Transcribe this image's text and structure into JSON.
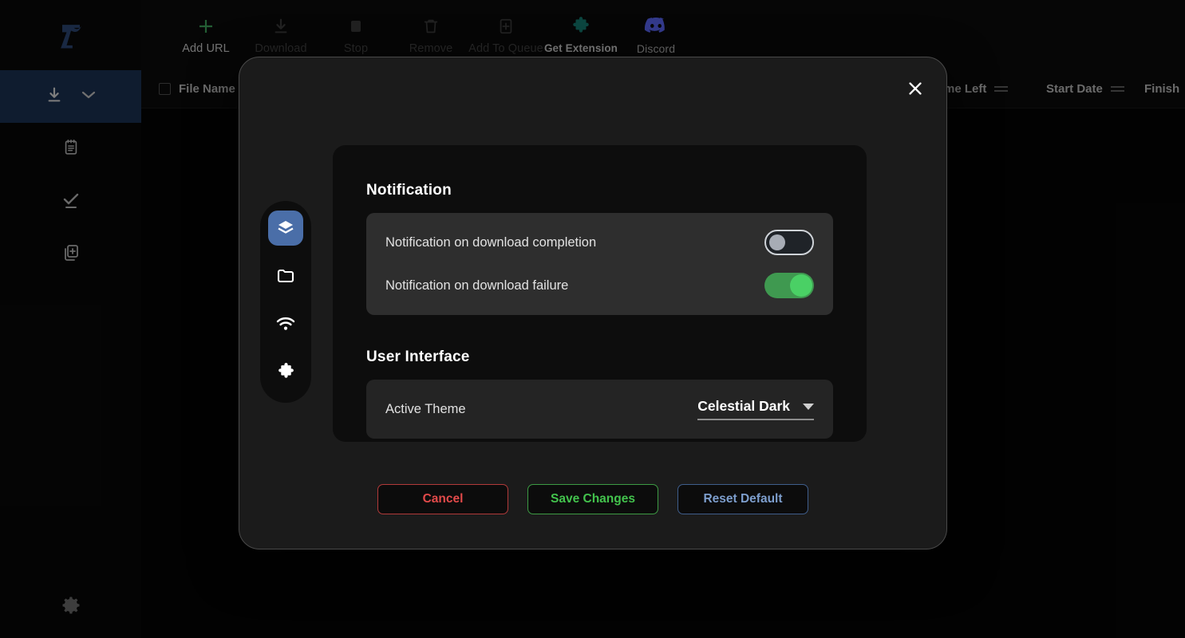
{
  "app": {
    "logo_name": "zapp-logo"
  },
  "toolbar": {
    "items": [
      {
        "label": "Add URL",
        "icon": "plus-icon",
        "state": "enabled"
      },
      {
        "label": "Download",
        "icon": "download-icon",
        "state": "disabled"
      },
      {
        "label": "Stop",
        "icon": "stop-icon",
        "state": "disabled"
      },
      {
        "label": "Remove",
        "icon": "trash-icon",
        "state": "disabled"
      },
      {
        "label": "Add To Queue",
        "icon": "add-to-queue-icon",
        "state": "disabled"
      },
      {
        "label": "Get Extension",
        "icon": "puzzle-icon",
        "state": "accent"
      },
      {
        "label": "Discord",
        "icon": "discord-icon",
        "state": "discord"
      }
    ]
  },
  "sidebar": {
    "items": [
      {
        "name": "downloads",
        "icon": "download-icon",
        "active": true
      },
      {
        "name": "queue",
        "icon": "clipboard-icon",
        "active": false
      },
      {
        "name": "completed",
        "icon": "check-icon",
        "active": false
      },
      {
        "name": "add-queue",
        "icon": "add-copy-icon",
        "active": false
      }
    ],
    "settings_icon": "gear-icon"
  },
  "table": {
    "columns": {
      "file_name": "File Name",
      "time_left": "me Left",
      "start_date": "Start Date",
      "finish": "Finish"
    }
  },
  "modal": {
    "close_icon": "close-icon",
    "nav": [
      {
        "name": "general",
        "icon": "layers-icon",
        "active": true
      },
      {
        "name": "downloads",
        "icon": "folder-icon",
        "active": false
      },
      {
        "name": "network",
        "icon": "wifi-icon",
        "active": false
      },
      {
        "name": "extension",
        "icon": "puzzle-icon",
        "active": false
      }
    ],
    "notification": {
      "title": "Notification",
      "rows": [
        {
          "label": "Notification on download completion",
          "enabled": false
        },
        {
          "label": "Notification on download failure",
          "enabled": true
        }
      ]
    },
    "user_interface": {
      "title": "User Interface",
      "theme_label": "Active Theme",
      "theme_value": "Celestial Dark",
      "theme_caret": "chevron-down-icon"
    },
    "buttons": {
      "cancel": "Cancel",
      "save": "Save Changes",
      "reset": "Reset Default"
    }
  },
  "colors": {
    "accent_blue": "#4a6ea8",
    "toggle_on": "#3f9950",
    "cancel_red": "#e24a4a",
    "save_green": "#43c34d",
    "reset_blue": "#7d9ecd"
  }
}
